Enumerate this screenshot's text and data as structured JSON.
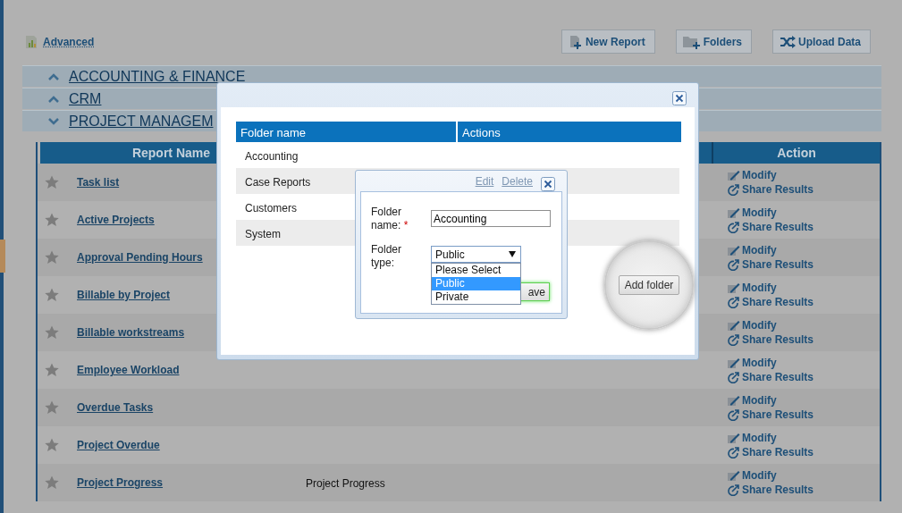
{
  "toolbar": {
    "advanced_link": "Advanced",
    "buttons": [
      {
        "label": "New Report",
        "kind": "new-report"
      },
      {
        "label": "Folders",
        "kind": "folders"
      },
      {
        "label": "Upload Data",
        "kind": "upload"
      }
    ]
  },
  "sections": [
    {
      "title": "ACCOUNTING & FINANCE",
      "expanded": false
    },
    {
      "title": "CRM",
      "expanded": false
    },
    {
      "title": "PROJECT MANAGEM",
      "expanded": true
    }
  ],
  "reports_table": {
    "columns": [
      "Report Name",
      "Action"
    ],
    "rows": [
      {
        "name": "Task list",
        "modify": "Modify",
        "share": "Share Results"
      },
      {
        "name": "Active Projects",
        "modify": "Modify",
        "share": "Share Results"
      },
      {
        "name": "Approval Pending Hours",
        "modify": "Modify",
        "share": "Share Results"
      },
      {
        "name": "Billable by Project",
        "modify": "Modify",
        "share": "Share Results"
      },
      {
        "name": "Billable workstreams",
        "modify": "Modify",
        "share": "Share Results"
      },
      {
        "name": "Employee Workload",
        "modify": "Modify",
        "share": "Share Results"
      },
      {
        "name": "Overdue Tasks",
        "modify": "Modify",
        "share": "Share Results"
      },
      {
        "name": "Project Overdue",
        "modify": "Modify",
        "share": "Share Results"
      },
      {
        "name": "Project Progress",
        "column_2": "Project Progress",
        "modify": "Modify",
        "share": "Share Results"
      }
    ]
  },
  "folders_dialog": {
    "columns": [
      "Folder name",
      "Actions"
    ],
    "rows": [
      "Accounting",
      "Case Reports",
      "Customers",
      "System"
    ],
    "add_button": "Add folder"
  },
  "folder_editor": {
    "links": [
      {
        "label": "Edit",
        "disabled": true
      },
      {
        "label": "Delete",
        "disabled": true
      }
    ],
    "name_label": "Folder name:",
    "required_mark": "*",
    "name_value": "Accounting",
    "type_label": "Folder type:",
    "type_value": "Public",
    "options": [
      {
        "label": "Please Select",
        "selected": false
      },
      {
        "label": "Public",
        "selected": true
      },
      {
        "label": "Private",
        "selected": false
      }
    ],
    "save_button": "ave"
  }
}
